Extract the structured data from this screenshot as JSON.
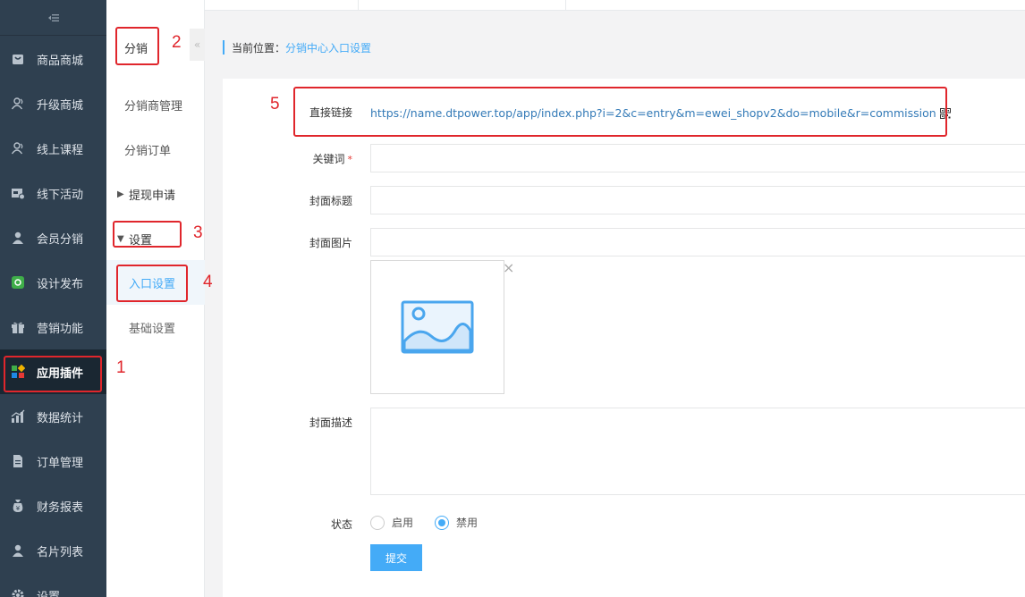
{
  "sidebar": {
    "items": [
      {
        "label": "商品商城",
        "icon": "bag-icon"
      },
      {
        "label": "升级商城",
        "icon": "users-icon"
      },
      {
        "label": "线上课程",
        "icon": "users-icon"
      },
      {
        "label": "线下活动",
        "icon": "store-icon"
      },
      {
        "label": "会员分销",
        "icon": "user-icon"
      },
      {
        "label": "设计发布",
        "icon": "design-icon"
      },
      {
        "label": "营销功能",
        "icon": "gift-icon"
      },
      {
        "label": "应用插件",
        "icon": "apps-icon"
      },
      {
        "label": "数据统计",
        "icon": "chart-icon"
      },
      {
        "label": "订单管理",
        "icon": "document-icon"
      },
      {
        "label": "财务报表",
        "icon": "money-icon"
      },
      {
        "label": "名片列表",
        "icon": "user-icon"
      },
      {
        "label": "设置",
        "icon": "gear-icon"
      }
    ],
    "active_index": 7
  },
  "submenu": {
    "title": "分销",
    "items": [
      "分销商管理",
      "分销订单"
    ],
    "groups": [
      {
        "label": "提现申请",
        "expanded": false
      },
      {
        "label": "设置",
        "expanded": true,
        "children": [
          "入口设置",
          "基础设置"
        ]
      }
    ],
    "collapse_symbol": "«"
  },
  "breadcrumb": {
    "prefix": "当前位置：",
    "current": "分销中心入口设置"
  },
  "form": {
    "direct_link_label": "直接链接",
    "direct_link_value": "https://name.dtpower.top/app/index.php?i=2&c=entry&m=ewei_shopv2&do=mobile&r=commission",
    "keyword_label": "关键词",
    "required_mark": "*",
    "keyword_value": "",
    "cover_title_label": "封面标题",
    "cover_title_value": "",
    "cover_image_label": "封面图片",
    "cover_image_value": "",
    "cover_desc_label": "封面描述",
    "cover_desc_value": "",
    "status_label": "状态",
    "status_options": [
      "启用",
      "禁用"
    ],
    "status_selected": "禁用",
    "submit_label": "提交",
    "remove_image_symbol": "×"
  },
  "annotations": [
    "1",
    "2",
    "3",
    "4",
    "5"
  ],
  "colors": {
    "sidebar_bg": "#2f4050",
    "accent": "#44abf7",
    "annotation_red": "#e0262c"
  }
}
